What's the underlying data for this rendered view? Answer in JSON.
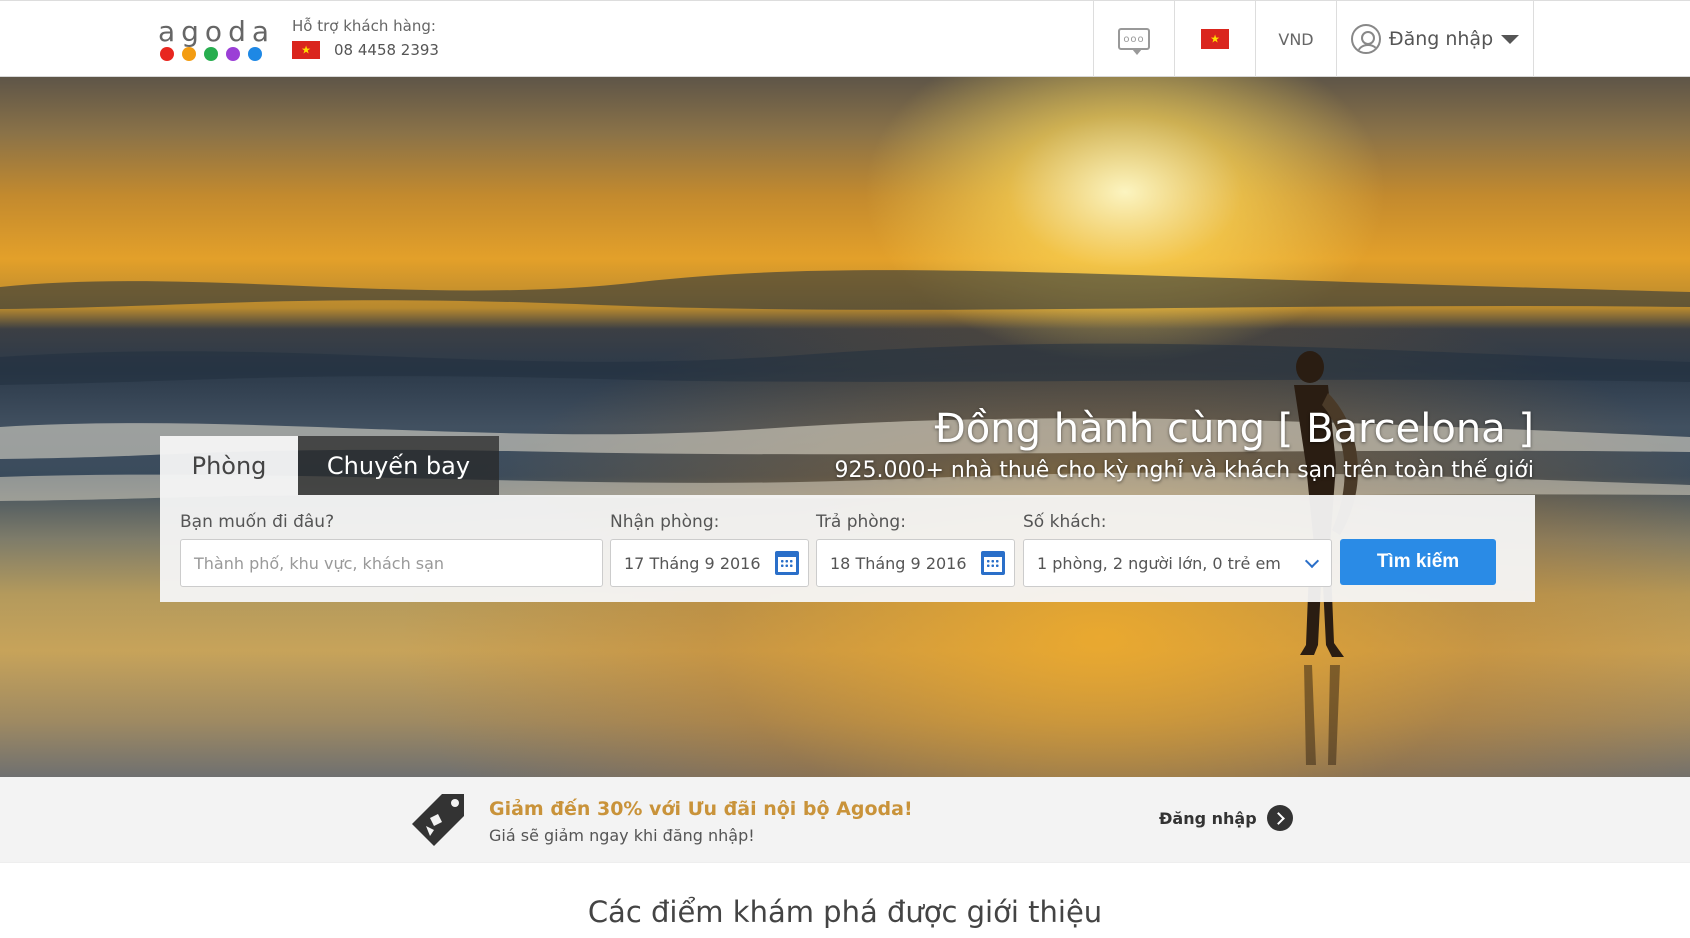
{
  "header": {
    "logo_text": "agoda",
    "logo_dot_colors": [
      "#e8261f",
      "#f39c12",
      "#27ae4f",
      "#9b3fd6",
      "#1e88e5"
    ],
    "support_label": "Hỗ trợ khách hàng:",
    "support_phone": "08 4458 2393",
    "currency": "VND",
    "login_label": "Đăng nhập",
    "chat_icon_glyph": "ooo"
  },
  "hero": {
    "title": "Đồng hành cùng [ Barcelona ]",
    "subtitle": "925.000+ nhà thuê cho kỳ nghỉ và khách sạn trên toàn thế giới"
  },
  "search": {
    "tabs": [
      {
        "label": "Phòng",
        "active": true
      },
      {
        "label": "Chuyến bay",
        "active": false
      }
    ],
    "destination_label": "Bạn muốn đi đâu?",
    "destination_placeholder": "Thành phố, khu vực, khách sạn",
    "checkin_label": "Nhận phòng:",
    "checkin_value": "17 Tháng 9 2016",
    "checkout_label": "Trả phòng:",
    "checkout_value": "18 Tháng 9 2016",
    "guests_label": "Số khách:",
    "guests_value": "1 phòng, 2 người lớn, 0 trẻ em",
    "search_button": "Tìm kiếm"
  },
  "promo": {
    "title": "Giảm đến 30% với Ưu đãi nội bộ Agoda!",
    "subtitle": "Giá sẽ giảm ngay khi đăng nhập!",
    "login_label": "Đăng nhập"
  },
  "section_title": "Các điểm khám phá được giới thiệu",
  "colors": {
    "accent_blue": "#2a8be6",
    "promo_gold": "#c9933a",
    "vn_flag_red": "#da251d",
    "vn_flag_star": "#ffde00"
  }
}
